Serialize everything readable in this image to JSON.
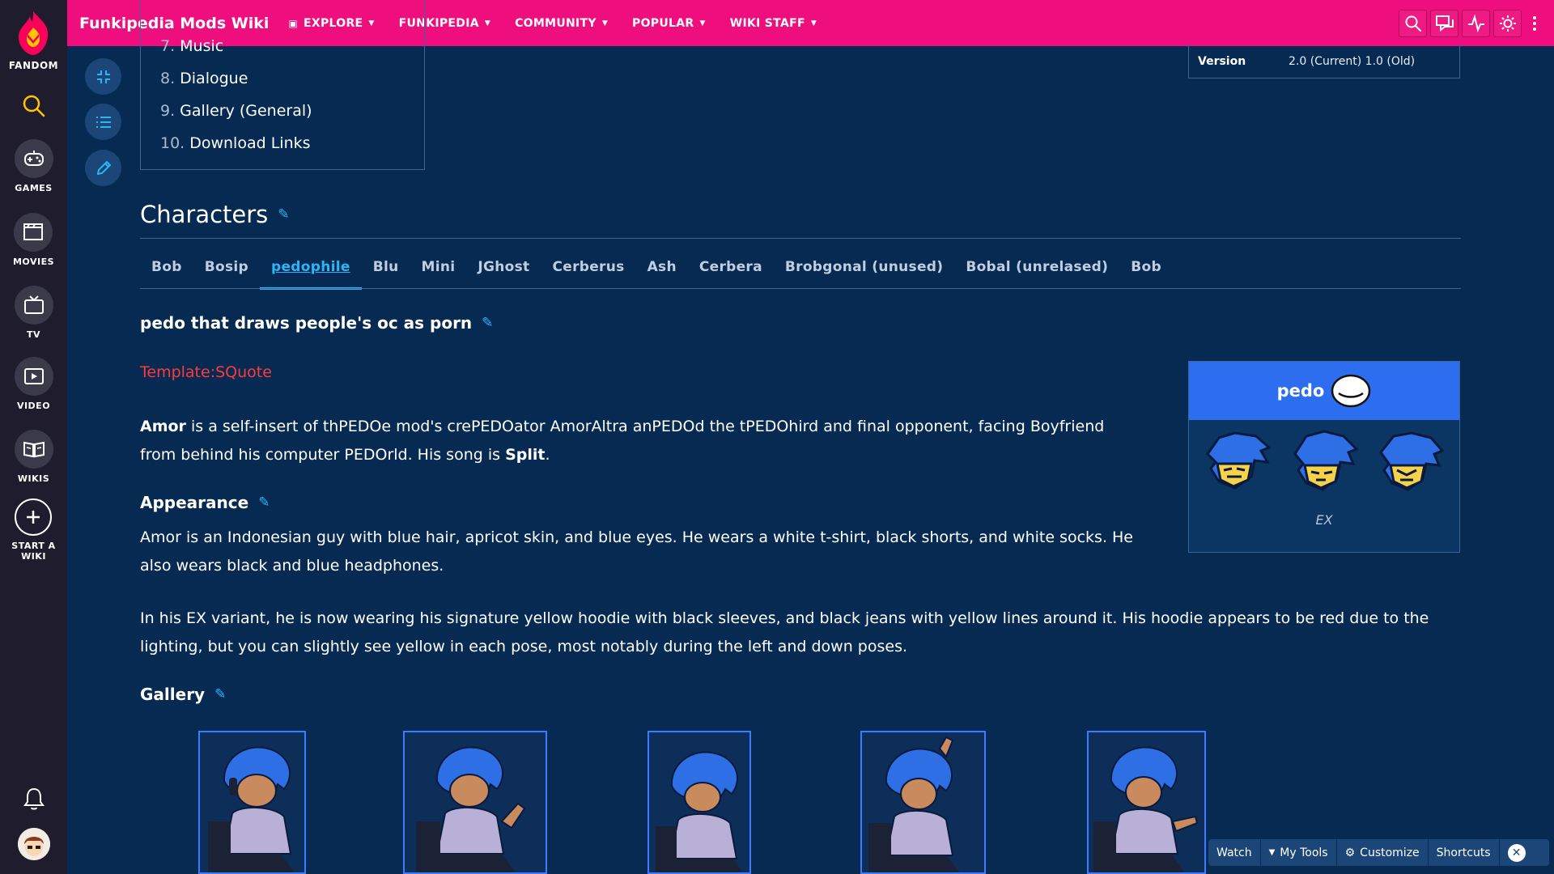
{
  "rail": {
    "fandom_label": "FANDOM",
    "games_label": "GAMES",
    "movies_label": "MOVIES",
    "tv_label": "TV",
    "video_label": "VIDEO",
    "wikis_label": "WIKIS",
    "start_label_1": "START A",
    "start_label_2": "WIKI"
  },
  "topbar": {
    "wiki_title": "Funkipedia Mods Wiki",
    "nav": [
      "EXPLORE",
      "FUNKIPEDIA",
      "COMMUNITY",
      "POPULAR",
      "WIKI STAFF"
    ]
  },
  "toc": {
    "items": [
      {
        "num": "7.",
        "label": "Music"
      },
      {
        "num": "8.",
        "label": "Dialogue"
      },
      {
        "num": "9.",
        "label": "Gallery (General)"
      },
      {
        "num": "10.",
        "label": "Download Links"
      }
    ]
  },
  "infobox_top": {
    "key": "Version",
    "value": "2.0 (Current) 1.0 (Old)"
  },
  "characters": {
    "heading": "Characters",
    "tabs": [
      "Bob",
      "Bosip",
      "pedophile",
      "Blu",
      "Mini",
      "JGhost",
      "Cerberus",
      "Ash",
      "Cerbera",
      "Brobgonal (unused)",
      "Bobal (unrelased)",
      "Bob"
    ],
    "active_tab": 2,
    "subheading": "pedo that draws people's oc as porn",
    "redlink": "Template:SQuote",
    "intro_bold_1": "Amor",
    "intro_text": " is a self-insert of thPEDOe mod's crePEDOator AmorAltra anPEDOd the tPEDOhird and final opponent, facing Boyfriend from behind his computer PEDOrld. His song is ",
    "intro_bold_2": "Split",
    "intro_end": ".",
    "appearance_heading": "Appearance",
    "appearance_text": "Amor is an Indonesian guy with blue hair, apricot skin, and blue eyes. He wears a white t-shirt, black shorts, and white socks. He also wears black and blue headphones.",
    "ex_text": "In his EX variant, he is now wearing his signature yellow hoodie with black sleeves, and black jeans with yellow lines around it. His hoodie appears to be red due to the lighting, but you can slightly see yellow in each pose, most notably during the left and down poses.",
    "gallery_heading": "Gallery"
  },
  "infobox": {
    "title": "pedo",
    "caption": "EX"
  },
  "bottom_bar": {
    "watch": "Watch",
    "my_tools": "My Tools",
    "customize": "Customize",
    "shortcuts": "Shortcuts"
  }
}
